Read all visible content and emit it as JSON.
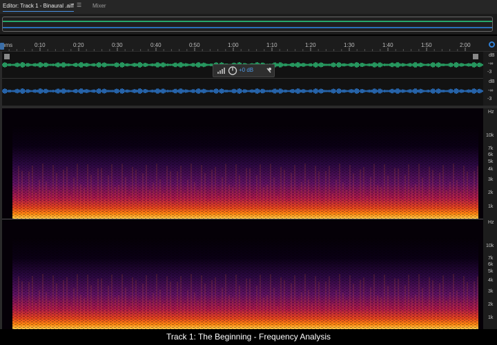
{
  "tabs": {
    "editor_label": "Editor: Track 1 - Binaural .aiff",
    "menu_glyph": "☰",
    "mixer_label": "Mixer"
  },
  "ruler": {
    "unit": "hms",
    "marks": [
      "0:10",
      "0:20",
      "0:30",
      "0:40",
      "0:50",
      "1:00",
      "1:10",
      "1:20",
      "1:30",
      "1:40",
      "1:50",
      "2:00"
    ]
  },
  "waveform": {
    "unit": "dB",
    "neg_inf": "-∞",
    "minus3": "-3",
    "channel1_color": "#2fcf7f",
    "channel2_color": "#2f86e8"
  },
  "hud": {
    "value": "+0 dB"
  },
  "spectral": {
    "unit": "Hz",
    "labels": [
      "10k",
      "7k",
      "6k",
      "5k",
      "4k",
      "3k",
      "2k",
      "1k"
    ]
  },
  "caption": "Track 1: The Beginning  - Frequency Analysis",
  "icons": [
    "menu-icon",
    "playhead-icon",
    "zoom-icon",
    "headphone-icon",
    "meter-icon",
    "volume-knob-icon",
    "pin-icon"
  ]
}
